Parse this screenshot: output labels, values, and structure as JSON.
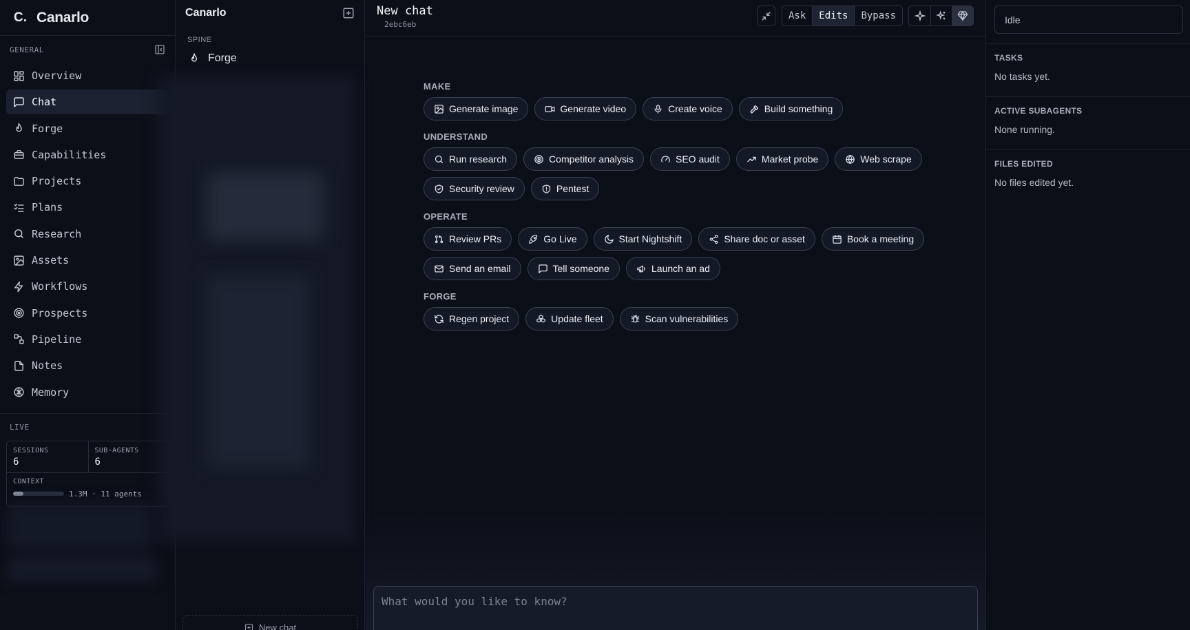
{
  "brand": {
    "mark": "C.",
    "name": "Canarlo",
    "dot": "."
  },
  "nav": {
    "section_general": "GENERAL",
    "items": [
      {
        "label": "Overview",
        "icon": "grid-icon"
      },
      {
        "label": "Chat",
        "icon": "chat-icon",
        "active": true
      },
      {
        "label": "Forge",
        "icon": "flame-icon"
      },
      {
        "label": "Capabilities",
        "icon": "toolbox-icon"
      },
      {
        "label": "Projects",
        "icon": "folder-icon"
      },
      {
        "label": "Plans",
        "icon": "checklist-icon"
      },
      {
        "label": "Research",
        "icon": "search-icon"
      },
      {
        "label": "Assets",
        "icon": "image-icon"
      },
      {
        "label": "Workflows",
        "icon": "bolt-icon"
      },
      {
        "label": "Prospects",
        "icon": "target-icon"
      },
      {
        "label": "Pipeline",
        "icon": "workflow-icon"
      },
      {
        "label": "Notes",
        "icon": "file-icon"
      },
      {
        "label": "Memory",
        "icon": "brain-icon"
      }
    ],
    "section_live": "LIVE",
    "live": {
      "sessions_label": "SESSIONS",
      "sessions_value": "6",
      "subagents_label": "SUB-AGENTS",
      "subagents_value": "6",
      "context_label": "CONTEXT",
      "context_text": "1.3M · 11 agents",
      "context_fill": 0.2
    }
  },
  "chatlist": {
    "title": "Canarlo",
    "spine_label": "SPINE",
    "spine_item": "Forge",
    "new_chat": "New chat"
  },
  "main": {
    "title": "New chat",
    "hash": "2ebc6eb",
    "modes": [
      "Ask",
      "Edits",
      "Bypass"
    ],
    "active_mode": "Edits",
    "groups": [
      {
        "label": "MAKE",
        "chips": [
          {
            "label": "Generate image",
            "icon": "image-icon"
          },
          {
            "label": "Generate video",
            "icon": "video-icon"
          },
          {
            "label": "Create voice",
            "icon": "mic-icon"
          },
          {
            "label": "Build something",
            "icon": "hammer-icon"
          }
        ]
      },
      {
        "label": "UNDERSTAND",
        "chips": [
          {
            "label": "Run research",
            "icon": "search-icon"
          },
          {
            "label": "Competitor analysis",
            "icon": "target-icon"
          },
          {
            "label": "SEO audit",
            "icon": "gauge-icon"
          },
          {
            "label": "Market probe",
            "icon": "trend-up-icon"
          },
          {
            "label": "Web scrape",
            "icon": "globe-icon"
          },
          {
            "label": "Security review",
            "icon": "shield-check-icon"
          },
          {
            "label": "Pentest",
            "icon": "shield-alert-icon"
          }
        ]
      },
      {
        "label": "OPERATE",
        "chips": [
          {
            "label": "Review PRs",
            "icon": "git-pr-icon"
          },
          {
            "label": "Go Live",
            "icon": "rocket-icon"
          },
          {
            "label": "Start Nightshift",
            "icon": "moon-icon"
          },
          {
            "label": "Share doc or asset",
            "icon": "share-icon"
          },
          {
            "label": "Book a meeting",
            "icon": "calendar-icon"
          },
          {
            "label": "Send an email",
            "icon": "mail-icon"
          },
          {
            "label": "Tell someone",
            "icon": "message-icon"
          },
          {
            "label": "Launch an ad",
            "icon": "megaphone-icon"
          }
        ]
      },
      {
        "label": "FORGE",
        "chips": [
          {
            "label": "Regen project",
            "icon": "refresh-icon"
          },
          {
            "label": "Update fleet",
            "icon": "boxes-icon"
          },
          {
            "label": "Scan vulnerabilities",
            "icon": "bug-icon"
          }
        ]
      }
    ],
    "composer_placeholder": "What would you like to know?"
  },
  "right": {
    "status": "Idle",
    "tasks_label": "TASKS",
    "tasks_text": "No tasks yet.",
    "subagents_label": "ACTIVE SUBAGENTS",
    "subagents_text": "None running.",
    "files_label": "FILES EDITED",
    "files_text": "No files edited yet."
  }
}
